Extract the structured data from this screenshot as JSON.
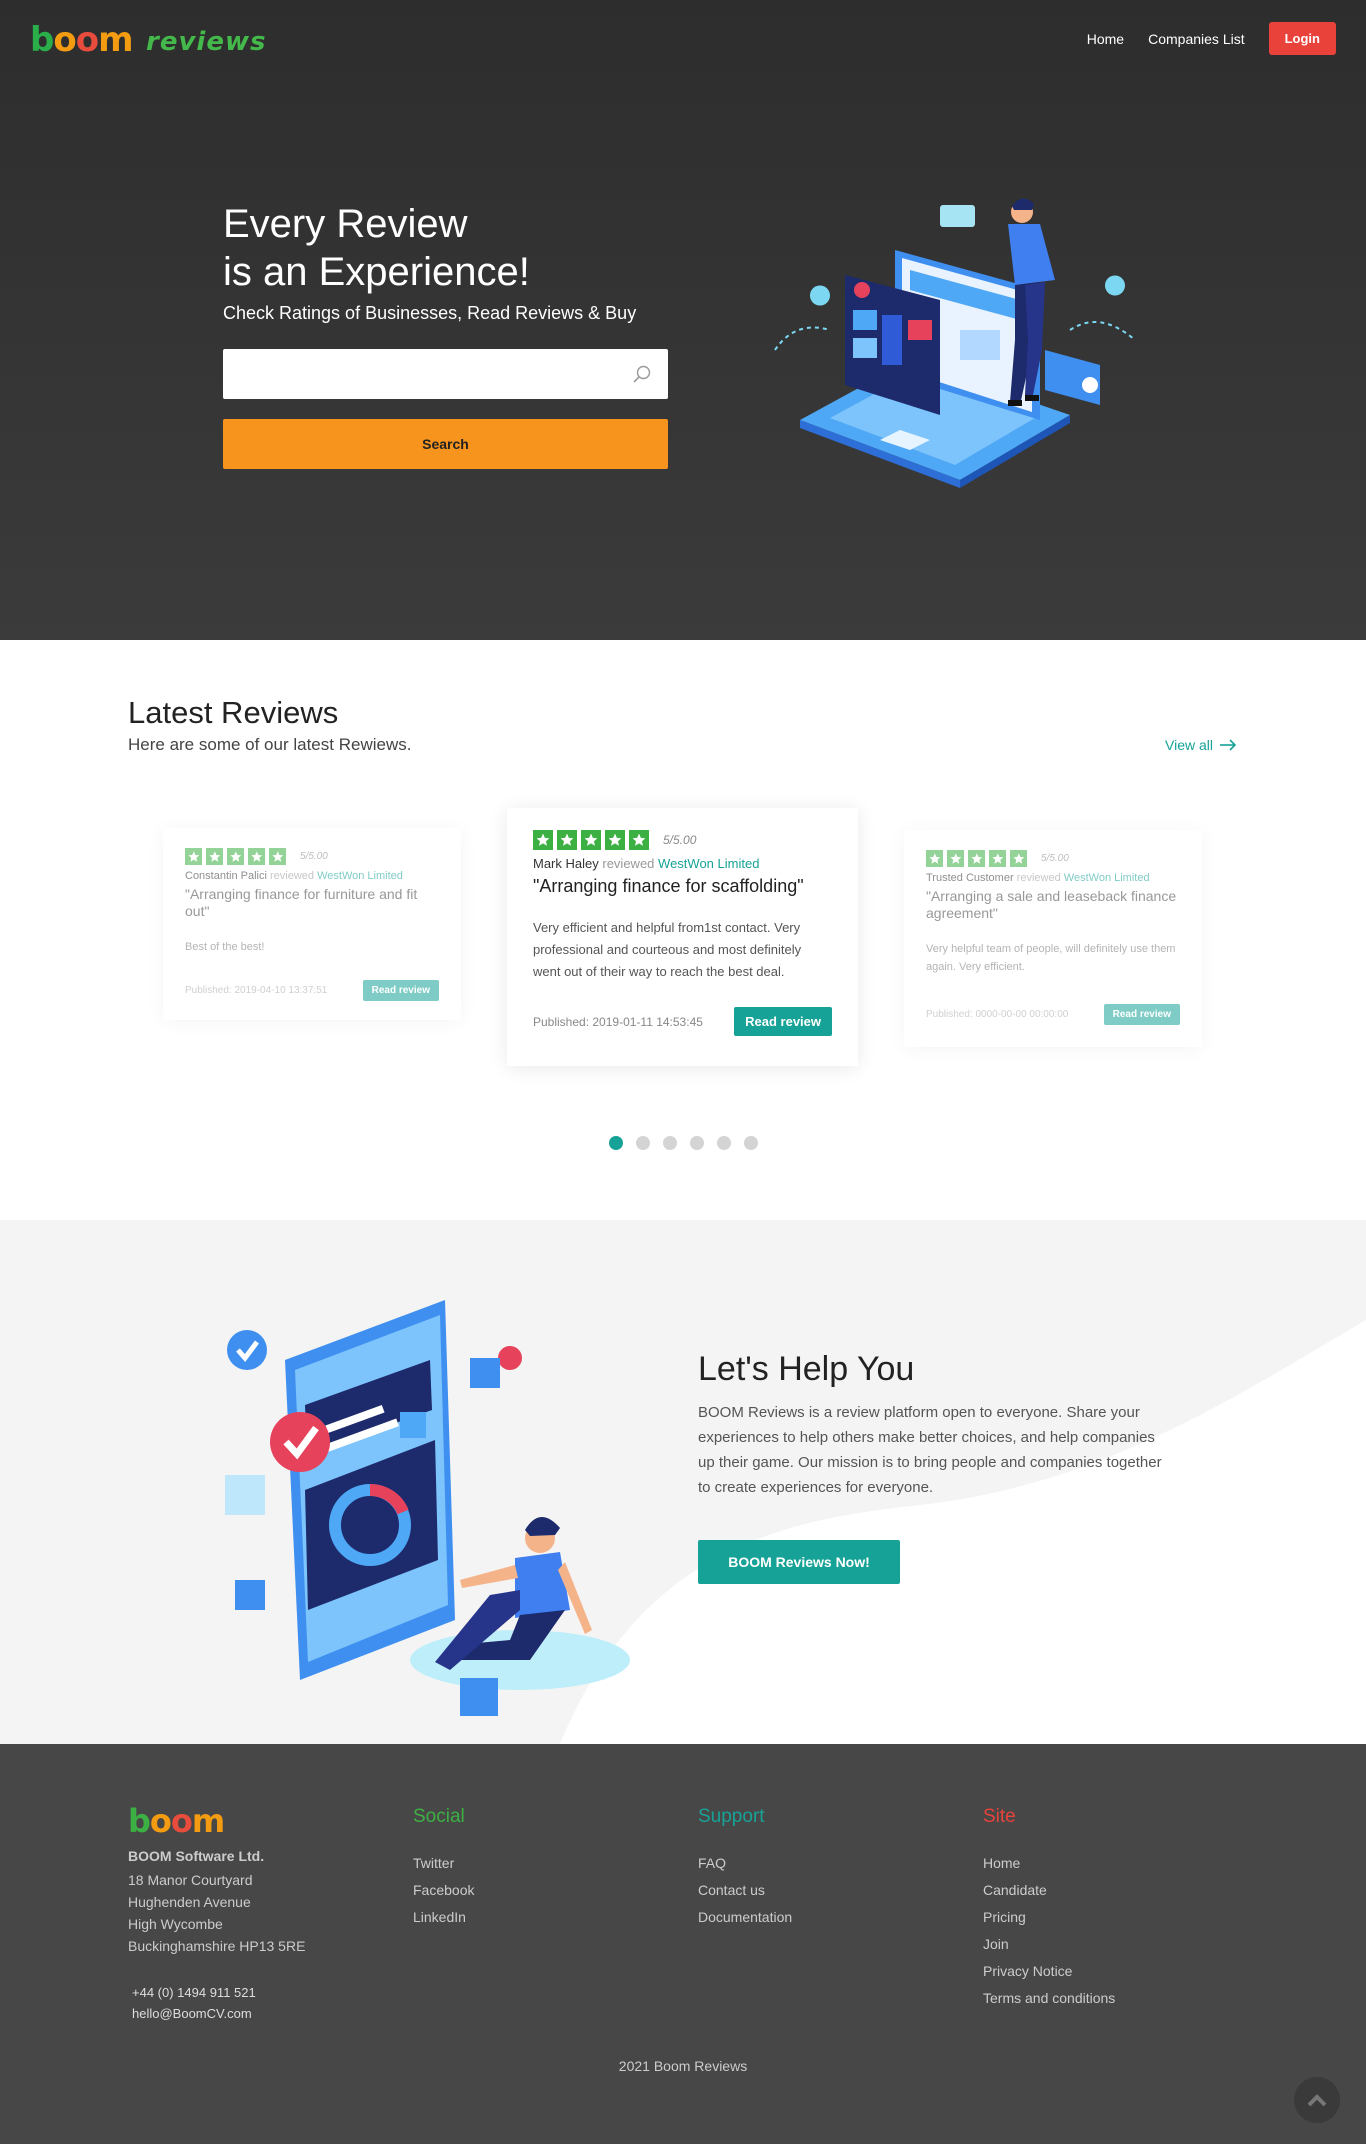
{
  "brand": {
    "logo": "boom",
    "logo_suffix": "reviews",
    "colors": {
      "green": "#3cb043",
      "teal": "#17a297",
      "orange": "#f7941d",
      "red": "#e8423b"
    }
  },
  "nav": {
    "home": "Home",
    "companies": "Companies List",
    "login": "Login"
  },
  "hero": {
    "title_line1": "Every Review",
    "title_line2": "is an Experience!",
    "subtitle": "Check Ratings of Businesses, Read Reviews & Buy",
    "search_placeholder": "",
    "search_button": "Search"
  },
  "latest": {
    "title": "Latest Reviews",
    "subtitle": "Here are some of our latest Rewiews.",
    "view_all": "View all",
    "reviewed_word": "reviewed",
    "cards": [
      {
        "rating": "5/5.00",
        "reviewer": "Constantin Palici",
        "company": "WestWon Limited",
        "title": "\"Arranging finance for furniture and fit out\"",
        "body": "Best of the best!",
        "published": "Published: 2019-04-10 13:37:51",
        "button": "Read review"
      },
      {
        "rating": "5/5.00",
        "reviewer": "Mark Haley",
        "company": "WestWon Limited",
        "title": "\"Arranging finance for scaffolding\"",
        "body": "Very efficient and helpful from1st contact. Very professional and courteous and most definitely went out of their way to reach the best deal.",
        "published": "Published: 2019-01-11 14:53:45",
        "button": "Read review"
      },
      {
        "rating": "5/5.00",
        "reviewer": "Trusted Customer",
        "company": "WestWon Limited",
        "title": "\"Arranging a sale and leaseback finance agreement\"",
        "body": "Very helpful team of people, will definitely use them again. Very efficient.",
        "published": "Published: 0000-00-00 00:00:00",
        "button": "Read review"
      }
    ],
    "carousel_pages": 6,
    "carousel_active": 1
  },
  "help": {
    "title": "Let's Help You",
    "text": "BOOM Reviews is a review platform open to everyone. Share your experiences to help others make better choices, and help companies up their game. Our mission is to bring people and companies together to create experiences for everyone.",
    "button": "BOOM Reviews Now!"
  },
  "footer": {
    "logo": "boom",
    "company": "BOOM Software Ltd.",
    "address": [
      "18 Manor Courtyard",
      "Hughenden Avenue",
      "High Wycombe",
      "Buckinghamshire HP13 5RE"
    ],
    "phone": "+44 (0) 1494 911 521",
    "email": "hello@BoomCV.com",
    "social": {
      "title": "Social",
      "links": [
        "Twitter",
        "Facebook",
        "LinkedIn"
      ]
    },
    "support": {
      "title": "Support",
      "links": [
        "FAQ",
        "Contact us",
        "Documentation"
      ]
    },
    "site": {
      "title": "Site",
      "links": [
        "Home",
        "Candidate",
        "Pricing",
        "Join",
        "Privacy Notice",
        "Terms and conditions"
      ]
    },
    "copyright": "2021 Boom Reviews"
  }
}
